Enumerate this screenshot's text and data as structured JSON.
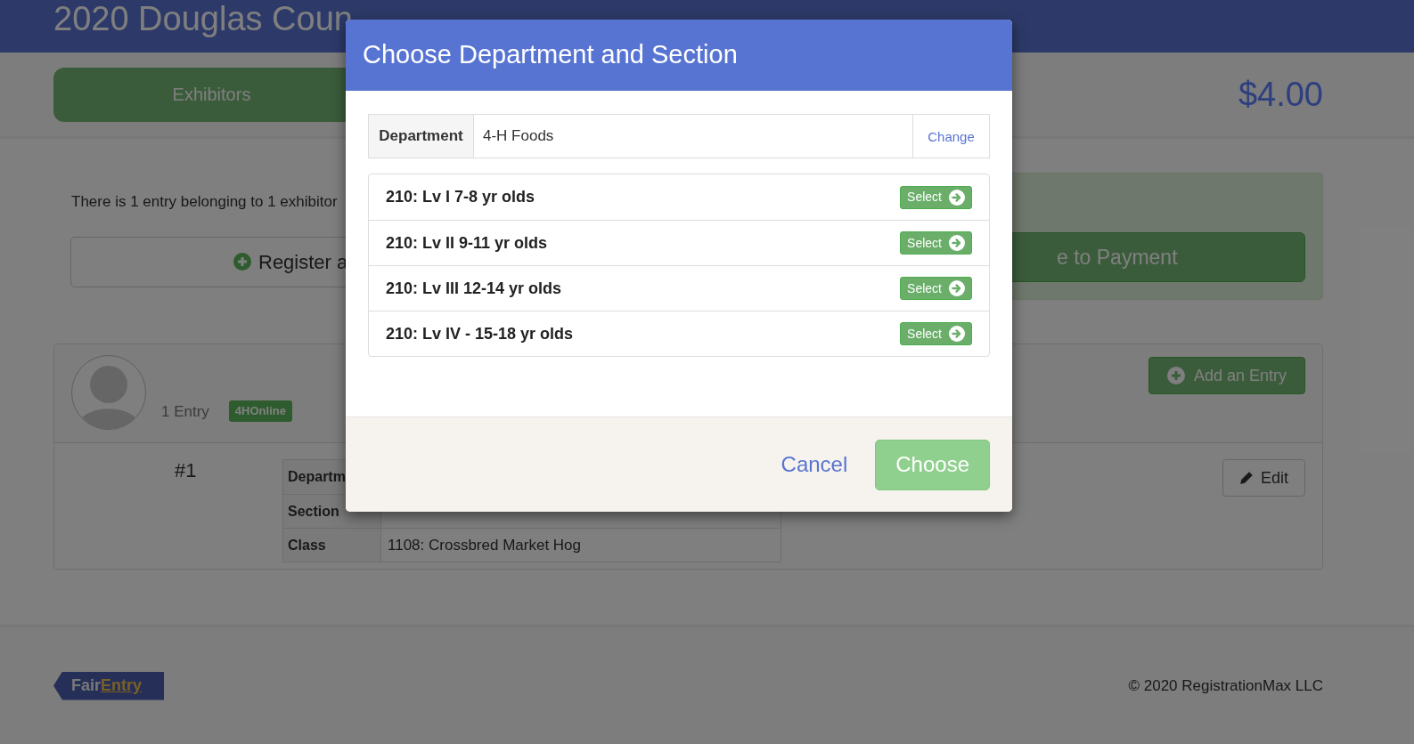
{
  "header": {
    "title": "2020 Douglas Coun"
  },
  "nav": {
    "button": "Exhibitors",
    "total": "$4.00"
  },
  "summary": {
    "text": "There is 1 entry belonging to 1 exhibitor",
    "register_button": "Register a",
    "payment_button": "e to Payment"
  },
  "exhibitor": {
    "entry_count": "1 Entry",
    "badge": "4HOnline",
    "add_button": "Add an Entry",
    "entry_number": "#1",
    "edit_button": "Edit",
    "details": [
      {
        "label": "Departm"
      },
      {
        "label": "Section"
      },
      {
        "label": "Class",
        "value": "1108: Crossbred Market Hog"
      }
    ]
  },
  "footer": {
    "logo": [
      "Fair",
      "Entry"
    ],
    "copyright": "© 2020 RegistrationMax LLC"
  },
  "dialog": {
    "title": "Choose Department and Section",
    "department": {
      "label": "Department",
      "value": "4-H Foods",
      "change_link": "Change"
    },
    "sections": [
      {
        "name": "210: Lv I 7-8 yr olds",
        "button": "Select"
      },
      {
        "name": "210: Lv II 9-11 yr olds",
        "button": "Select"
      },
      {
        "name": "210: Lv III 12-14 yr olds",
        "button": "Select"
      },
      {
        "name": "210: Lv IV - 15-18 yr olds",
        "button": "Select"
      }
    ],
    "cancel": "Cancel",
    "choose": {
      "label": "Choose",
      "disabled": true
    }
  }
}
